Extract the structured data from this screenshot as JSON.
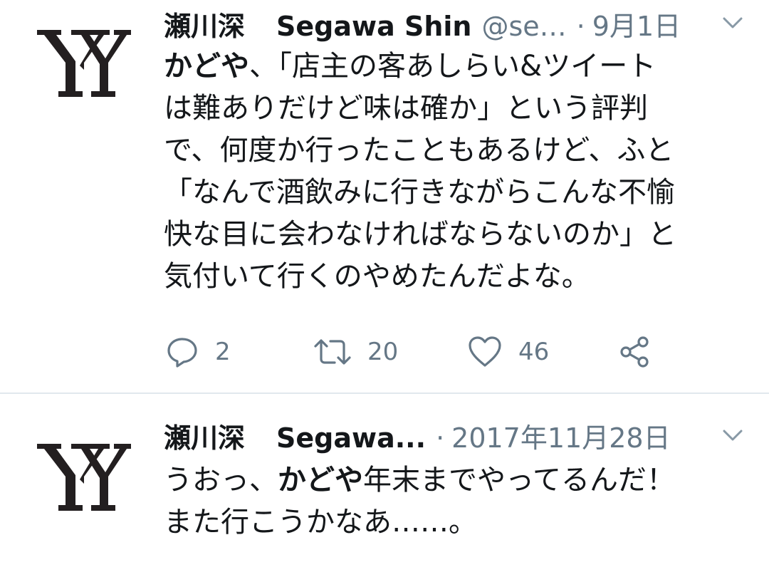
{
  "tweets": [
    {
      "name": "瀬川深",
      "display_name": "Segawa Shin",
      "handle": "@se…",
      "date": "9月1日",
      "text_lines": [
        [
          {
            "t": "かどや",
            "b": true
          },
          {
            "t": "、「店主の客あしらい&ツイート",
            "b": false
          }
        ],
        [
          {
            "t": "は難ありだけど味は確か」という評判",
            "b": false
          }
        ],
        [
          {
            "t": "で、何度か行ったこともあるけど、ふと",
            "b": false
          }
        ],
        [
          {
            "t": "「なんで酒飲みに行きながらこんな不愉",
            "b": false
          }
        ],
        [
          {
            "t": "快な目に会わなければならないのか」と",
            "b": false
          }
        ],
        [
          {
            "t": "気付いて行くのやめたんだよな。",
            "b": false
          }
        ]
      ],
      "reply_count": "2",
      "retweet_count": "20",
      "like_count": "46"
    },
    {
      "name": "瀬川深",
      "display_name": "Segawa...",
      "handle": "",
      "date": "2017年11月28日",
      "text_lines": [
        [
          {
            "t": "うおっ、",
            "b": false
          },
          {
            "t": "かどや",
            "b": true
          },
          {
            "t": "年末までやってるんだ！",
            "b": false
          }
        ],
        [
          {
            "t": "また行こうかなあ……。",
            "b": false
          }
        ]
      ]
    }
  ],
  "icons": {
    "avatar": "yy-logo",
    "menu": "chevron-down-icon",
    "reply": "reply-icon",
    "retweet": "retweet-icon",
    "like": "heart-icon",
    "share": "share-icon"
  },
  "colors": {
    "text": "#14171a",
    "muted": "#657786",
    "divider": "#e1e8ed"
  }
}
